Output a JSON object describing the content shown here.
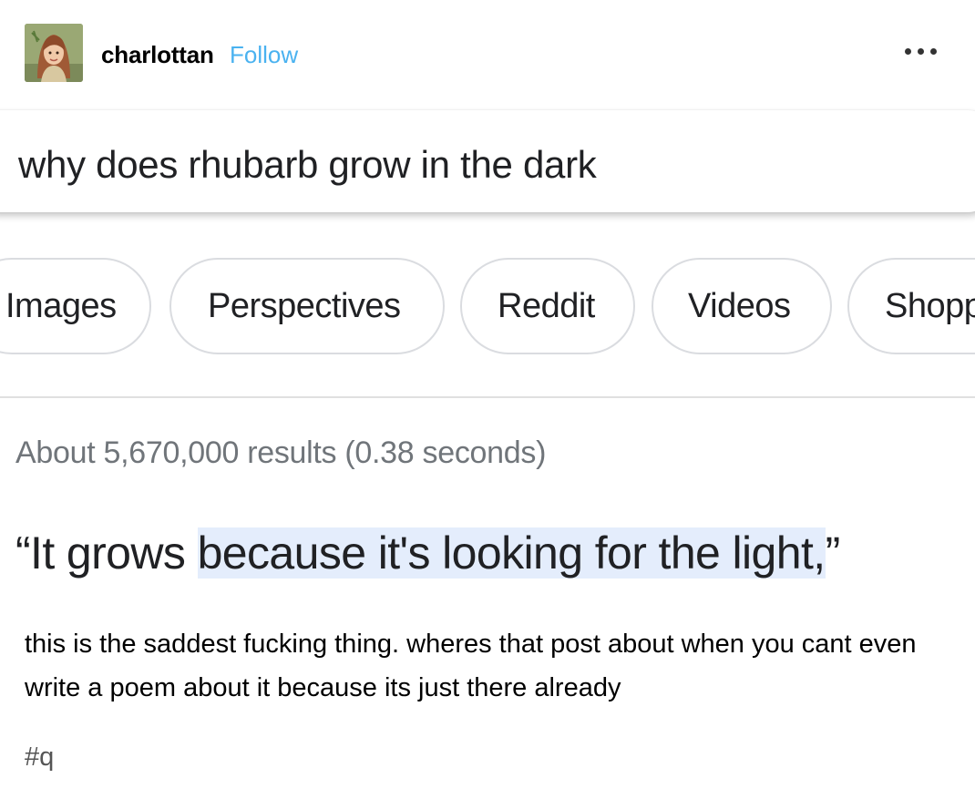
{
  "post": {
    "username": "charlottan",
    "follow_label": "Follow",
    "caption": "this is the saddest fucking thing. wheres that post about when you cant even write a poem about it because its just there already",
    "tags": [
      "#q"
    ]
  },
  "search": {
    "query": "why does rhubarb grow in the dark",
    "chips": [
      "Images",
      "Perspectives",
      "Reddit",
      "Videos",
      "Shopp"
    ],
    "result_stats": "About 5,670,000 results (0.38 seconds)",
    "snippet_before": "“It grows ",
    "snippet_highlight": "because it's looking for the light,",
    "snippet_after": "”"
  },
  "colors": {
    "follow": "#4ab2f0",
    "highlight": "#e4edfc",
    "stats_gray": "#70757a",
    "chip_border": "#dadce0"
  }
}
